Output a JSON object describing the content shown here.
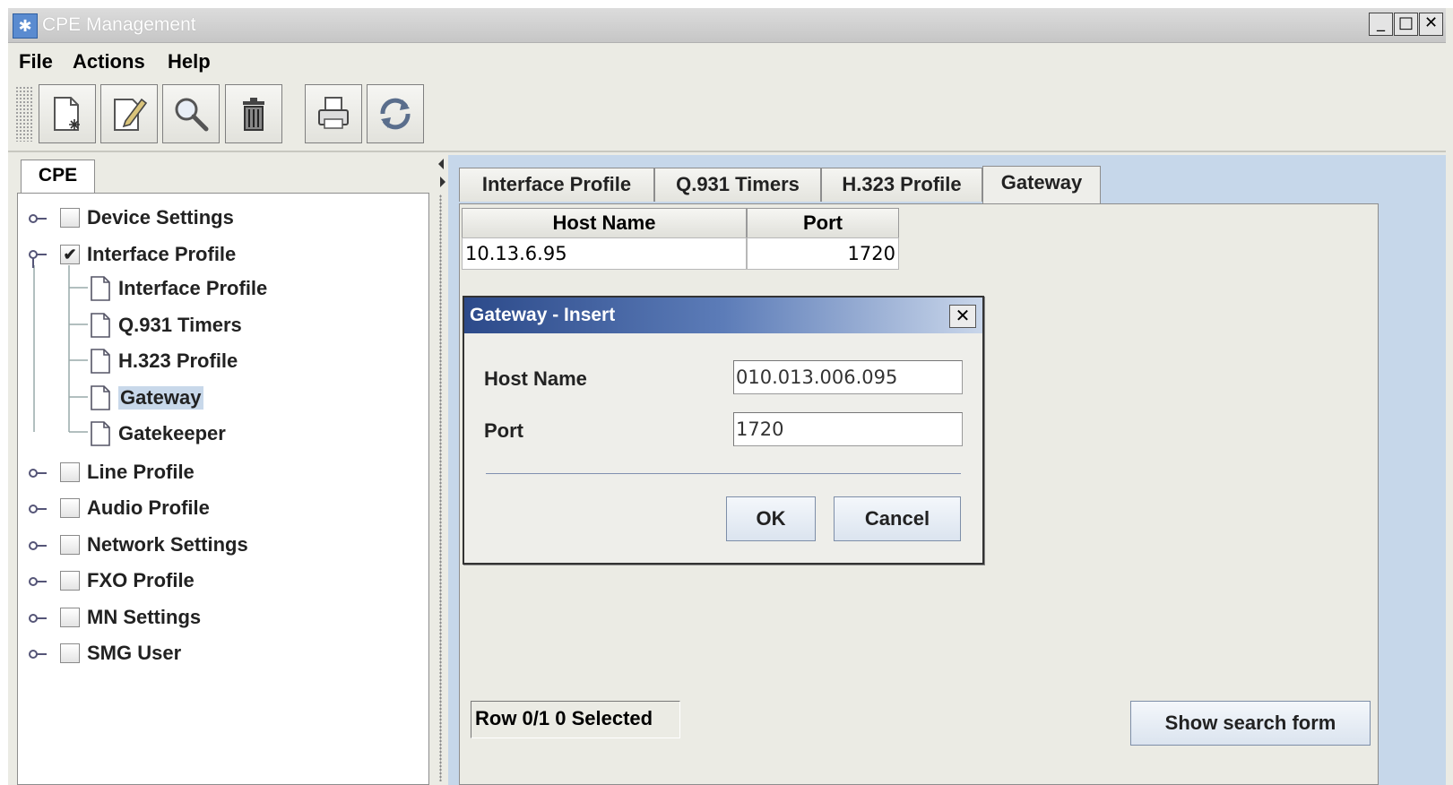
{
  "window": {
    "title": "CPE Management",
    "minimize": "_",
    "maximize": "□",
    "close": "✕"
  },
  "menu": [
    "File",
    "Actions",
    "Help"
  ],
  "toolbar": [
    {
      "icon": "new-document-icon"
    },
    {
      "icon": "edit-icon"
    },
    {
      "icon": "search-icon"
    },
    {
      "icon": "delete-trash-icon"
    },
    {
      "icon": "print-icon"
    },
    {
      "icon": "refresh-icon"
    }
  ],
  "left_panel": {
    "tab": "CPE",
    "tree": [
      {
        "label": "Device Settings",
        "checked": false
      },
      {
        "label": "Interface Profile",
        "checked": true,
        "expanded": true,
        "children": [
          "Interface Profile",
          "Q.931 Timers",
          "H.323 Profile",
          "Gateway",
          "Gatekeeper"
        ]
      },
      {
        "label": "Line Profile",
        "checked": false
      },
      {
        "label": "Audio Profile",
        "checked": false
      },
      {
        "label": "Network Settings",
        "checked": false
      },
      {
        "label": "FXO Profile",
        "checked": false
      },
      {
        "label": "MN Settings",
        "checked": false
      },
      {
        "label": "SMG User",
        "checked": false
      }
    ],
    "selected": "Gateway"
  },
  "tabs": [
    "Interface Profile",
    "Q.931 Timers",
    "H.323 Profile",
    "Gateway"
  ],
  "active_tab": "Gateway",
  "table": {
    "columns": [
      "Host Name",
      "Port"
    ],
    "rows": [
      [
        "10.13.6.95",
        "1720"
      ]
    ]
  },
  "status": "Row 0/1   0 Selected",
  "search_button": "Show search form",
  "dialog": {
    "title": "Gateway - Insert",
    "close": "✕",
    "fields": [
      {
        "label": "Host Name",
        "value": "010.013.006.095"
      },
      {
        "label": "Port",
        "value": "1720"
      }
    ],
    "ok": "OK",
    "cancel": "Cancel"
  }
}
